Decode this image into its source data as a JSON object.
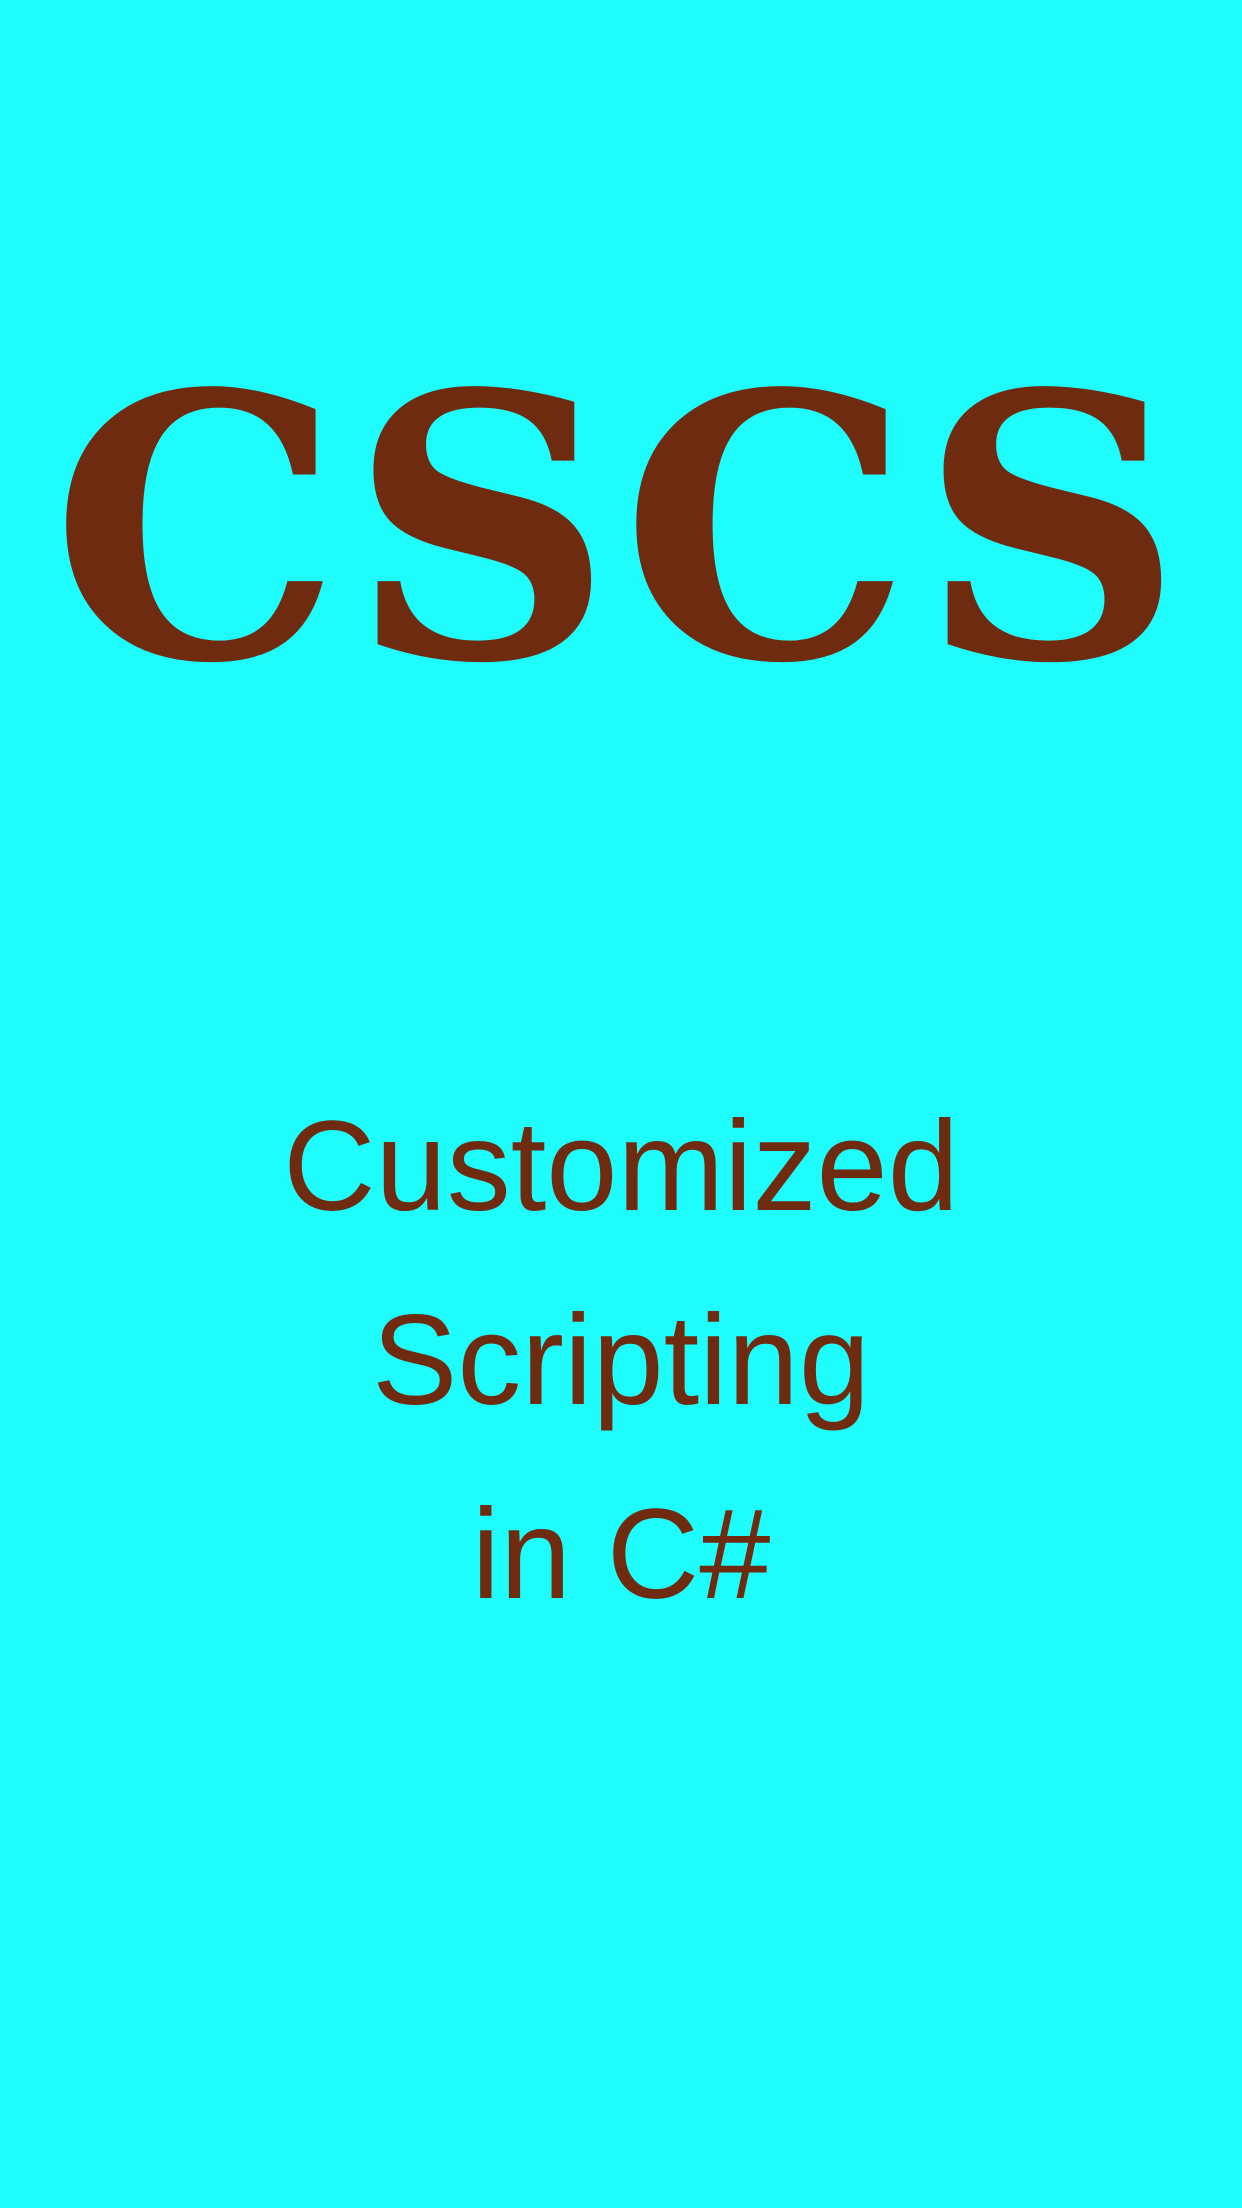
{
  "logo": {
    "text": "CSCS"
  },
  "subtitle": {
    "lines": [
      "Customized",
      "Scripting",
      "in C#"
    ]
  },
  "colors": {
    "background": "#1ffcfc",
    "text": "#6f2b10"
  }
}
